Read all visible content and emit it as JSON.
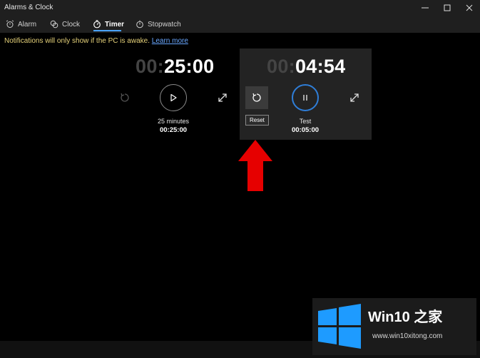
{
  "window": {
    "title": "Alarms & Clock",
    "controls": [
      "minimize-icon",
      "maximize-icon",
      "close-icon"
    ]
  },
  "tabs": [
    {
      "label": "Alarm",
      "icon": "alarm-icon",
      "active": false
    },
    {
      "label": "Clock",
      "icon": "world-clock-icon",
      "active": false
    },
    {
      "label": "Timer",
      "icon": "timer-icon",
      "active": true
    },
    {
      "label": "Stopwatch",
      "icon": "stopwatch-icon",
      "active": false
    }
  ],
  "notice": {
    "text": "Notifications will only show if the PC is awake.",
    "link": "Learn more"
  },
  "timers": [
    {
      "time_dim": "00:",
      "time_bright": "25:00",
      "name": "25 minutes",
      "duration": "00:25:00",
      "state": "stopped"
    },
    {
      "time_dim": "00:",
      "time_bright": "04:54",
      "name": "Test",
      "duration": "00:05:00",
      "state": "running",
      "tooltip": "Reset"
    }
  ],
  "watermark": {
    "title": "Win10 之家",
    "url": "www.win10xitong.com"
  },
  "colors": {
    "accent": "#2f7ed8",
    "arrow": "#e60000",
    "notice_text": "#e6d27a",
    "link": "#69a7ff"
  }
}
